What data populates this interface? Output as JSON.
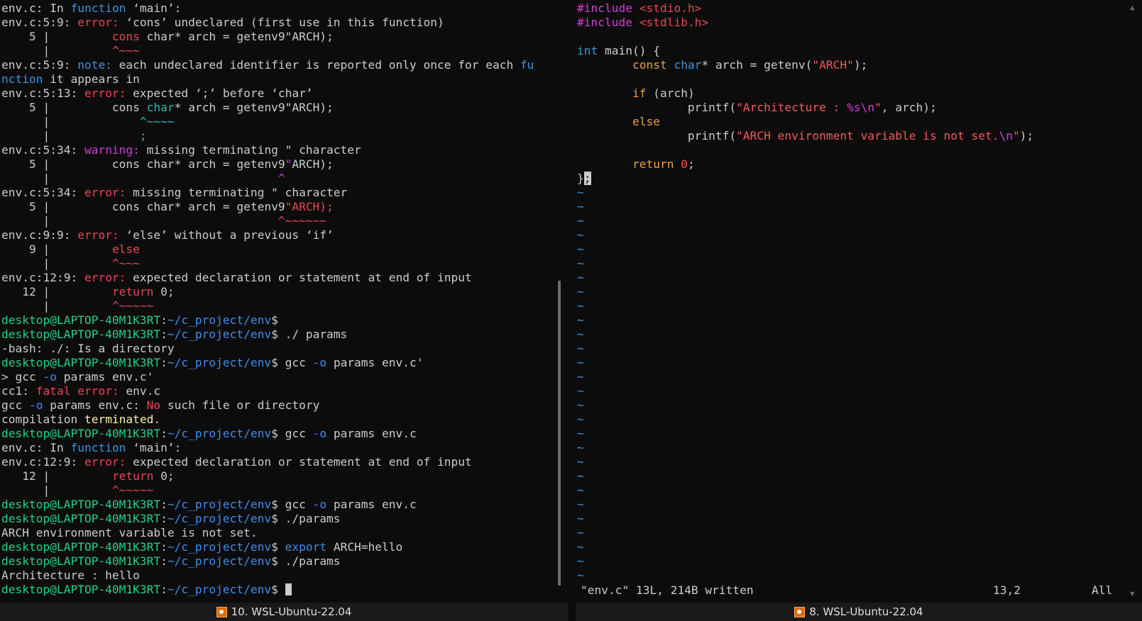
{
  "left_terminal": {
    "lines": [
      [
        {
          "t": "env.c: In ",
          "c": "c-white"
        },
        {
          "t": "function",
          "c": "c-cyan"
        },
        {
          "t": " ‘main’:",
          "c": "c-white"
        }
      ],
      [
        {
          "t": "env.c:5:9: ",
          "c": "c-white"
        },
        {
          "t": "error:",
          "c": "c-red"
        },
        {
          "t": " ‘cons’ undeclared (first use in this function)",
          "c": "c-white"
        }
      ],
      [
        {
          "t": "    5 |         ",
          "c": "c-white"
        },
        {
          "t": "cons",
          "c": "c-red"
        },
        {
          "t": " char* arch = getenv9\"ARCH);",
          "c": "c-white"
        }
      ],
      [
        {
          "t": "      |         ",
          "c": "c-white"
        },
        {
          "t": "^~~~",
          "c": "c-red"
        }
      ],
      [
        {
          "t": "env.c:5:9: ",
          "c": "c-white"
        },
        {
          "t": "note:",
          "c": "c-cyan"
        },
        {
          "t": " each undeclared identifier is reported only once for each ",
          "c": "c-white"
        },
        {
          "t": "fu",
          "c": "c-cyan"
        }
      ],
      [
        {
          "t": "nction",
          "c": "c-cyan"
        },
        {
          "t": " it appears in",
          "c": "c-white"
        }
      ],
      [
        {
          "t": "env.c:5:13: ",
          "c": "c-white"
        },
        {
          "t": "error:",
          "c": "c-red"
        },
        {
          "t": " expected ‘;’ before ‘char’",
          "c": "c-white"
        }
      ],
      [
        {
          "t": "    5 |         cons ",
          "c": "c-white"
        },
        {
          "t": "char",
          "c": "c-teal"
        },
        {
          "t": "* arch = getenv9\"ARCH);",
          "c": "c-white"
        }
      ],
      [
        {
          "t": "      |             ",
          "c": "c-white"
        },
        {
          "t": "^~~~~",
          "c": "c-teal"
        }
      ],
      [
        {
          "t": "      |             ",
          "c": "c-white"
        },
        {
          "t": ";",
          "c": "c-teal"
        }
      ],
      [
        {
          "t": "env.c:5:34: ",
          "c": "c-white"
        },
        {
          "t": "warning:",
          "c": "c-magenta"
        },
        {
          "t": " missing terminating \" character",
          "c": "c-white"
        }
      ],
      [
        {
          "t": "    5 |         cons char* arch = getenv9",
          "c": "c-white"
        },
        {
          "t": "\"",
          "c": "c-magenta"
        },
        {
          "t": "ARCH);",
          "c": "c-white"
        }
      ],
      [
        {
          "t": "      |                                 ",
          "c": "c-white"
        },
        {
          "t": "^",
          "c": "c-magenta"
        }
      ],
      [
        {
          "t": "env.c:5:34: ",
          "c": "c-white"
        },
        {
          "t": "error:",
          "c": "c-red"
        },
        {
          "t": " missing terminating \" character",
          "c": "c-white"
        }
      ],
      [
        {
          "t": "    5 |         cons char* arch = getenv9",
          "c": "c-white"
        },
        {
          "t": "\"ARCH);",
          "c": "c-red"
        }
      ],
      [
        {
          "t": "      |                                 ",
          "c": "c-white"
        },
        {
          "t": "^~~~~~~",
          "c": "c-red"
        }
      ],
      [
        {
          "t": "env.c:9:9: ",
          "c": "c-white"
        },
        {
          "t": "error:",
          "c": "c-red"
        },
        {
          "t": " ‘else’ without a previous ‘if’",
          "c": "c-white"
        }
      ],
      [
        {
          "t": "    9 |         ",
          "c": "c-white"
        },
        {
          "t": "else",
          "c": "c-red"
        }
      ],
      [
        {
          "t": "      |         ",
          "c": "c-white"
        },
        {
          "t": "^~~~",
          "c": "c-red"
        }
      ],
      [
        {
          "t": "env.c:12:9: ",
          "c": "c-white"
        },
        {
          "t": "error:",
          "c": "c-red"
        },
        {
          "t": " expected declaration or statement at end of input",
          "c": "c-white"
        }
      ],
      [
        {
          "t": "   12 |         ",
          "c": "c-white"
        },
        {
          "t": "return",
          "c": "c-red"
        },
        {
          "t": " 0;",
          "c": "c-white"
        }
      ],
      [
        {
          "t": "      |         ",
          "c": "c-white"
        },
        {
          "t": "^~~~~~",
          "c": "c-red"
        }
      ],
      [
        {
          "t": "desktop@LAPTOP-40M1K3RT",
          "c": "c-prompt"
        },
        {
          "t": ":",
          "c": "c-white"
        },
        {
          "t": "~/c_project/env",
          "c": "c-path"
        },
        {
          "t": "$",
          "c": "c-white"
        }
      ],
      [
        {
          "t": "desktop@LAPTOP-40M1K3RT",
          "c": "c-prompt"
        },
        {
          "t": ":",
          "c": "c-white"
        },
        {
          "t": "~/c_project/env",
          "c": "c-path"
        },
        {
          "t": "$ ./ params",
          "c": "c-white"
        }
      ],
      [
        {
          "t": "-bash: ./: Is a directory",
          "c": "c-white"
        }
      ],
      [
        {
          "t": "desktop@LAPTOP-40M1K3RT",
          "c": "c-prompt"
        },
        {
          "t": ":",
          "c": "c-white"
        },
        {
          "t": "~/c_project/env",
          "c": "c-path"
        },
        {
          "t": "$ gcc ",
          "c": "c-white"
        },
        {
          "t": "-o",
          "c": "c-path"
        },
        {
          "t": " params env.c'",
          "c": "c-white"
        }
      ],
      [
        {
          "t": "> gcc ",
          "c": "c-white"
        },
        {
          "t": "-o",
          "c": "c-path"
        },
        {
          "t": " params env.c'",
          "c": "c-white"
        }
      ],
      [
        {
          "t": "cc1: ",
          "c": "c-white"
        },
        {
          "t": "fatal error:",
          "c": "c-red"
        },
        {
          "t": " env.c",
          "c": "c-white"
        }
      ],
      [
        {
          "t": "gcc ",
          "c": "c-white"
        },
        {
          "t": "-o",
          "c": "c-path"
        },
        {
          "t": " params env.c: ",
          "c": "c-white"
        },
        {
          "t": "No",
          "c": "c-red"
        },
        {
          "t": " such file or directory",
          "c": "c-white"
        }
      ],
      [
        {
          "t": "compilation ",
          "c": "c-white"
        },
        {
          "t": "terminated",
          "c": "c-yellow"
        },
        {
          "t": ".",
          "c": "c-white"
        }
      ],
      [
        {
          "t": "desktop@LAPTOP-40M1K3RT",
          "c": "c-prompt"
        },
        {
          "t": ":",
          "c": "c-white"
        },
        {
          "t": "~/c_project/env",
          "c": "c-path"
        },
        {
          "t": "$ gcc ",
          "c": "c-white"
        },
        {
          "t": "-o",
          "c": "c-path"
        },
        {
          "t": " params env.c",
          "c": "c-white"
        }
      ],
      [
        {
          "t": "env.c: In ",
          "c": "c-white"
        },
        {
          "t": "function",
          "c": "c-cyan"
        },
        {
          "t": " ‘main’:",
          "c": "c-white"
        }
      ],
      [
        {
          "t": "env.c:12:9: ",
          "c": "c-white"
        },
        {
          "t": "error:",
          "c": "c-red"
        },
        {
          "t": " expected declaration or statement at end of input",
          "c": "c-white"
        }
      ],
      [
        {
          "t": "   12 |         ",
          "c": "c-white"
        },
        {
          "t": "return",
          "c": "c-red"
        },
        {
          "t": " 0;",
          "c": "c-white"
        }
      ],
      [
        {
          "t": "      |         ",
          "c": "c-white"
        },
        {
          "t": "^~~~~~",
          "c": "c-red"
        }
      ],
      [
        {
          "t": "desktop@LAPTOP-40M1K3RT",
          "c": "c-prompt"
        },
        {
          "t": ":",
          "c": "c-white"
        },
        {
          "t": "~/c_project/env",
          "c": "c-path"
        },
        {
          "t": "$ gcc ",
          "c": "c-white"
        },
        {
          "t": "-o",
          "c": "c-path"
        },
        {
          "t": " params env.c",
          "c": "c-white"
        }
      ],
      [
        {
          "t": "desktop@LAPTOP-40M1K3RT",
          "c": "c-prompt"
        },
        {
          "t": ":",
          "c": "c-white"
        },
        {
          "t": "~/c_project/env",
          "c": "c-path"
        },
        {
          "t": "$ ./params",
          "c": "c-white"
        }
      ],
      [
        {
          "t": "ARCH environment variable is not set.",
          "c": "c-white"
        }
      ],
      [
        {
          "t": "desktop@LAPTOP-40M1K3RT",
          "c": "c-prompt"
        },
        {
          "t": ":",
          "c": "c-white"
        },
        {
          "t": "~/c_project/env",
          "c": "c-path"
        },
        {
          "t": "$ ",
          "c": "c-white"
        },
        {
          "t": "export",
          "c": "c-path"
        },
        {
          "t": " ARCH=hello",
          "c": "c-white"
        }
      ],
      [
        {
          "t": "desktop@LAPTOP-40M1K3RT",
          "c": "c-prompt"
        },
        {
          "t": ":",
          "c": "c-white"
        },
        {
          "t": "~/c_project/env",
          "c": "c-path"
        },
        {
          "t": "$ ./params",
          "c": "c-white"
        }
      ],
      [
        {
          "t": "Architecture : hello",
          "c": "c-white"
        }
      ],
      [
        {
          "t": "desktop@LAPTOP-40M1K3RT",
          "c": "c-prompt"
        },
        {
          "t": ":",
          "c": "c-white"
        },
        {
          "t": "~/c_project/env",
          "c": "c-path"
        },
        {
          "t": "$ ",
          "c": "c-white"
        }
      ]
    ],
    "tab_label": "10. WSL-Ubuntu-22.04"
  },
  "right_editor": {
    "lines": [
      [
        {
          "t": "#include ",
          "c": "c-magenta"
        },
        {
          "t": "<stdio.h>",
          "c": "c-red"
        }
      ],
      [
        {
          "t": "#include ",
          "c": "c-magenta"
        },
        {
          "t": "<stdlib.h>",
          "c": "c-red"
        }
      ],
      [],
      [
        {
          "t": "int",
          "c": "c-cyan"
        },
        {
          "t": " main() {",
          "c": "c-white"
        }
      ],
      [
        {
          "t": "        ",
          "c": "c-white"
        },
        {
          "t": "const",
          "c": "c-orange"
        },
        {
          "t": " ",
          "c": "c-white"
        },
        {
          "t": "char",
          "c": "c-cyan"
        },
        {
          "t": "* arch = getenv(",
          "c": "c-white"
        },
        {
          "t": "\"ARCH\"",
          "c": "c-brightred"
        },
        {
          "t": ");",
          "c": "c-white"
        }
      ],
      [],
      [
        {
          "t": "        ",
          "c": "c-white"
        },
        {
          "t": "if",
          "c": "c-orange"
        },
        {
          "t": " (arch)",
          "c": "c-white"
        }
      ],
      [
        {
          "t": "                printf(",
          "c": "c-white"
        },
        {
          "t": "\"Architecture : ",
          "c": "c-brightred"
        },
        {
          "t": "%s\\n",
          "c": "c-magenta"
        },
        {
          "t": "\"",
          "c": "c-brightred"
        },
        {
          "t": ", arch);",
          "c": "c-white"
        }
      ],
      [
        {
          "t": "        ",
          "c": "c-white"
        },
        {
          "t": "else",
          "c": "c-orange"
        }
      ],
      [
        {
          "t": "                printf(",
          "c": "c-white"
        },
        {
          "t": "\"ARCH environment variable is not set.",
          "c": "c-brightred"
        },
        {
          "t": "\\n",
          "c": "c-magenta"
        },
        {
          "t": "\"",
          "c": "c-brightred"
        },
        {
          "t": ");",
          "c": "c-white"
        }
      ],
      [],
      [
        {
          "t": "        ",
          "c": "c-white"
        },
        {
          "t": "return",
          "c": "c-orange"
        },
        {
          "t": " ",
          "c": "c-white"
        },
        {
          "t": "0",
          "c": "c-brightred"
        },
        {
          "t": ";",
          "c": "c-white"
        }
      ],
      [
        {
          "t": "}",
          "c": "c-white"
        },
        {
          "t": ";",
          "c": "vim-cursor"
        }
      ]
    ],
    "tilde_count": 28,
    "status_message": "\"env.c\" 13L, 214B written",
    "status_position": "13,2",
    "status_percent": "All",
    "tab_label": "8. WSL-Ubuntu-22.04"
  },
  "icons": {
    "tab_icon": "terminal-icon",
    "scroll_up": "▲",
    "scroll_down": "▼"
  }
}
